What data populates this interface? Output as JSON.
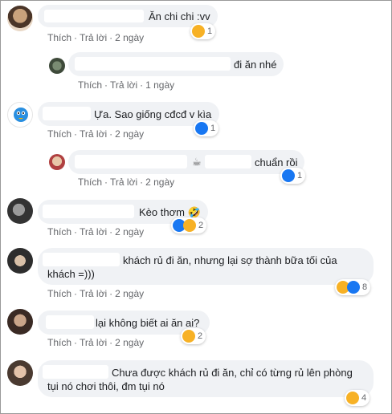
{
  "actions": {
    "like": "Thích",
    "reply": "Trả lời",
    "sep": "·"
  },
  "comments": [
    {
      "text": "Ăn chi chi :vv",
      "time": "2 ngày",
      "react_count": "1",
      "reactions": [
        "haha-icon"
      ]
    },
    {
      "text": "đi ăn nhé",
      "time": "1 ngày",
      "react_count": "",
      "reactions": []
    },
    {
      "text": "Ựa. Sao giống cđcđ v kìa",
      "time": "2 ngày",
      "react_count": "1",
      "reactions": [
        "like-icon"
      ]
    },
    {
      "text": "chuẩn rồi",
      "cup": "☕",
      "time": "2 ngày",
      "react_count": "1",
      "reactions": [
        "like-icon"
      ]
    },
    {
      "text": "Kèo thơm 🤣",
      "time": "2 ngày",
      "react_count": "2",
      "reactions": [
        "like-icon",
        "haha-icon"
      ]
    },
    {
      "line1": "khách rủ đi ăn, nhưng lại sợ thành bữa tối của",
      "line2": "khách =)))",
      "time": "2 ngày",
      "react_count": "8",
      "reactions": [
        "haha-icon",
        "like-icon"
      ]
    },
    {
      "text": "lại không biết ai ăn ai?",
      "time": "2 ngày",
      "react_count": "2",
      "reactions": [
        "haha-icon"
      ]
    },
    {
      "line1": "Chưa được khách rủ đi ăn, chỉ có từng rủ lên phòng",
      "line2": "tụi nó chơi thôi, đm tụi nó",
      "time": "2 ngày",
      "react_count": "4",
      "reactions": [
        "haha-icon"
      ]
    }
  ],
  "colors": {
    "bubble": "#f0f2f5",
    "like": "#1877f2",
    "haha": "#f7b125",
    "meta": "#65676b"
  }
}
